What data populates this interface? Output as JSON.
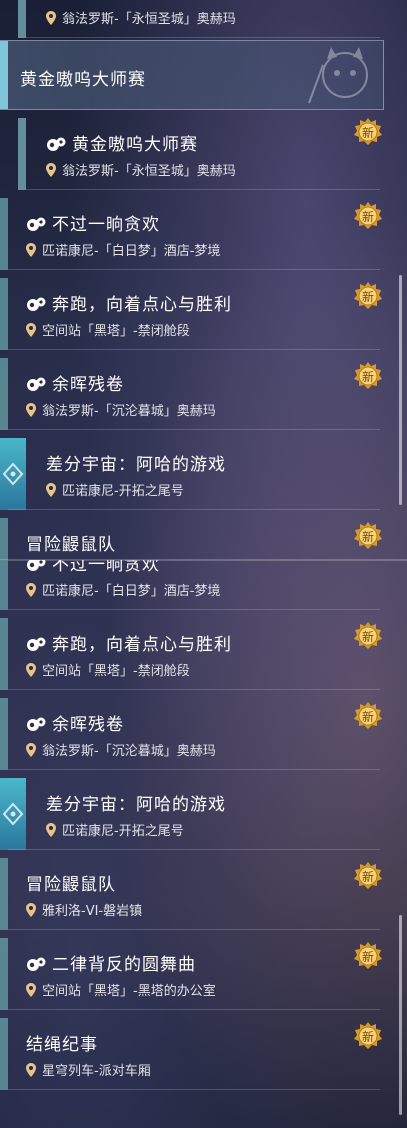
{
  "top_panel": {
    "cut_top": {
      "location": "翁法罗斯-「永恒圣城」奥赫玛"
    },
    "group_header": {
      "title": "黄金嗷呜大师赛"
    },
    "items": [
      {
        "title": "黄金嗷呜大师赛",
        "location": "翁法罗斯-「永恒圣城」奥赫玛",
        "badge": "新"
      },
      {
        "title": "不过一晌贪欢",
        "location": "匹诺康尼-「白日梦」酒店-梦境",
        "badge": "新"
      },
      {
        "title": "奔跑，向着点心与胜利",
        "location": "空间站「黑塔」-禁闭舱段",
        "badge": "新"
      },
      {
        "title": "余晖残卷",
        "location": "翁法罗斯-「沉沦暮城」奥赫玛",
        "badge": "新"
      },
      {
        "title": "差分宇宙：阿哈的游戏",
        "location": "匹诺康尼-开拓之尾号"
      },
      {
        "title": "冒险鼹鼠队",
        "badge": "新"
      }
    ]
  },
  "bottom_panel": {
    "items": [
      {
        "title": "不过一晌贪欢",
        "location": "匹诺康尼-「白日梦」酒店-梦境"
      },
      {
        "title": "奔跑，向着点心与胜利",
        "location": "空间站「黑塔」-禁闭舱段",
        "badge": "新"
      },
      {
        "title": "余晖残卷",
        "location": "翁法罗斯-「沉沦暮城」奥赫玛",
        "badge": "新"
      },
      {
        "title": "差分宇宙：阿哈的游戏",
        "location": "匹诺康尼-开拓之尾号"
      },
      {
        "title": "冒险鼹鼠队",
        "location": "雅利洛-VI-磐岩镇",
        "badge": "新"
      },
      {
        "title": "二律背反的圆舞曲",
        "location": "空间站「黑塔」-黑塔的办公室",
        "badge": "新"
      },
      {
        "title": "结绳纪事",
        "location": "星穹列车-派对车厢",
        "badge": "新"
      }
    ]
  },
  "icons": {
    "pin": "location-pin-icon",
    "glyph": "paw-quest-icon",
    "new": "new-badge-icon",
    "diff": "diamond-universe-icon"
  },
  "colors": {
    "accent": "#5c8f9a",
    "badge": "#e0a030",
    "text": "#ffffff"
  }
}
